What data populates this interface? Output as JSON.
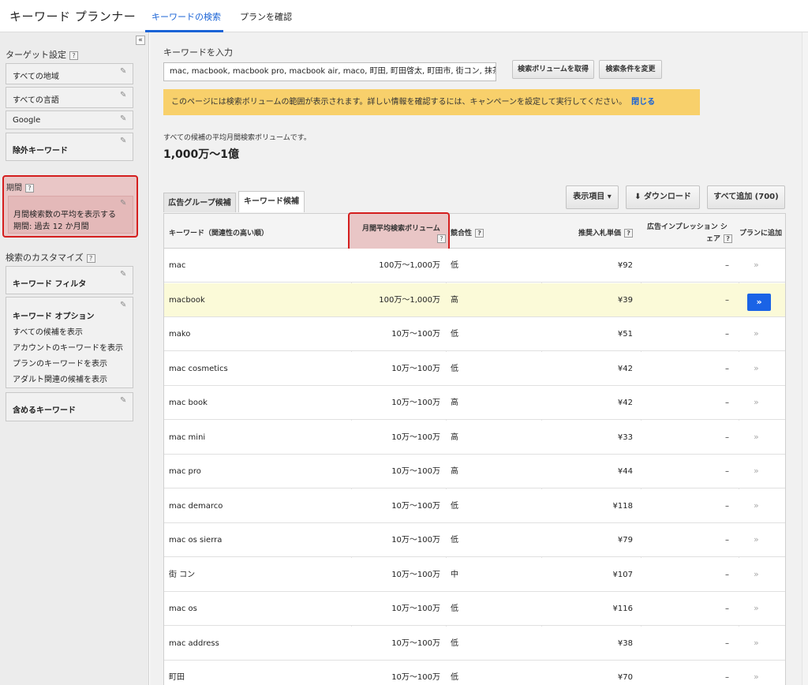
{
  "header": {
    "app_title": "キーワード プランナー",
    "tabs": [
      {
        "label": "キーワードの検索",
        "active": true
      },
      {
        "label": "プランを確認",
        "active": false
      }
    ]
  },
  "sidebar": {
    "collapse": "«",
    "target_heading": "ターゲット設定",
    "target_items": [
      "すべての地域",
      "すべての言語",
      "Google",
      "除外キーワード"
    ],
    "period": {
      "heading": "期間",
      "line1": "月間検索数の平均を表示する",
      "line2": "期間: 過去 12 か月間"
    },
    "customize_heading": "検索のカスタマイズ",
    "keyword_filter": "キーワード フィルタ",
    "keyword_options": {
      "title": "キーワード オプション",
      "items": [
        "すべての候補を表示",
        "アカウントのキーワードを表示",
        "プランのキーワードを表示",
        "アダルト関連の候補を表示"
      ]
    },
    "include_keywords": "含めるキーワード"
  },
  "main": {
    "input_label": "キーワードを入力",
    "input_value": "mac, macbook, macbook pro, macbook air, maco, 町田, 町田啓太, 町田市, 街コン, 抹茶",
    "get_volume_button": "検索ボリュームを取得",
    "change_criteria_button": "検索条件を変更",
    "notice_text": "このページには検索ボリュームの範囲が表示されます。詳しい情報を確認するには、キャンペーンを設定して実行してください。",
    "notice_close": "閉じる",
    "avg_label": "すべての候補の平均月間検索ボリュームです。",
    "avg_value": "1,000万〜1億",
    "tabs": [
      "広告グループ候補",
      "キーワード候補"
    ],
    "columns_button": "表示項目 ▾",
    "download_button": "ダウンロード",
    "add_all_button": "すべて追加 (700)"
  },
  "table": {
    "headers": {
      "keyword": "キーワード（関連性の高い順）",
      "volume": "月間平均検索ボリューム",
      "competition": "競合性",
      "bid": "推奨入札単価",
      "share_line1": "広告インプレッション シ",
      "share_line2": "ェア",
      "add": "プランに追加"
    },
    "rows": [
      {
        "keyword": "mac",
        "volume": "100万〜1,000万",
        "competition": "低",
        "bid": "¥92",
        "share": "–"
      },
      {
        "keyword": "macbook",
        "volume": "100万〜1,000万",
        "competition": "高",
        "bid": "¥39",
        "share": "–"
      },
      {
        "keyword": "mako",
        "volume": "10万〜100万",
        "competition": "低",
        "bid": "¥51",
        "share": "–"
      },
      {
        "keyword": "mac cosmetics",
        "volume": "10万〜100万",
        "competition": "低",
        "bid": "¥42",
        "share": "–"
      },
      {
        "keyword": "mac book",
        "volume": "10万〜100万",
        "competition": "高",
        "bid": "¥42",
        "share": "–"
      },
      {
        "keyword": "mac mini",
        "volume": "10万〜100万",
        "competition": "高",
        "bid": "¥33",
        "share": "–"
      },
      {
        "keyword": "mac pro",
        "volume": "10万〜100万",
        "competition": "高",
        "bid": "¥44",
        "share": "–"
      },
      {
        "keyword": "mac demarco",
        "volume": "10万〜100万",
        "competition": "低",
        "bid": "¥118",
        "share": "–"
      },
      {
        "keyword": "mac os sierra",
        "volume": "10万〜100万",
        "competition": "低",
        "bid": "¥79",
        "share": "–"
      },
      {
        "keyword": "街 コン",
        "volume": "10万〜100万",
        "competition": "中",
        "bid": "¥107",
        "share": "–"
      },
      {
        "keyword": "mac os",
        "volume": "10万〜100万",
        "competition": "低",
        "bid": "¥116",
        "share": "–"
      },
      {
        "keyword": "mac address",
        "volume": "10万〜100万",
        "competition": "低",
        "bid": "¥38",
        "share": "–"
      },
      {
        "keyword": "町田",
        "volume": "10万〜100万",
        "competition": "低",
        "bid": "¥70",
        "share": "–"
      }
    ],
    "highlight_row": 1,
    "add_glyph": "»",
    "help_glyph": "?"
  },
  "colors": {
    "accent": "#1a63d6",
    "highlight_box": "#d41e1e",
    "notice_bg": "#f8d06b",
    "row_highlight": "#fbfad8"
  }
}
